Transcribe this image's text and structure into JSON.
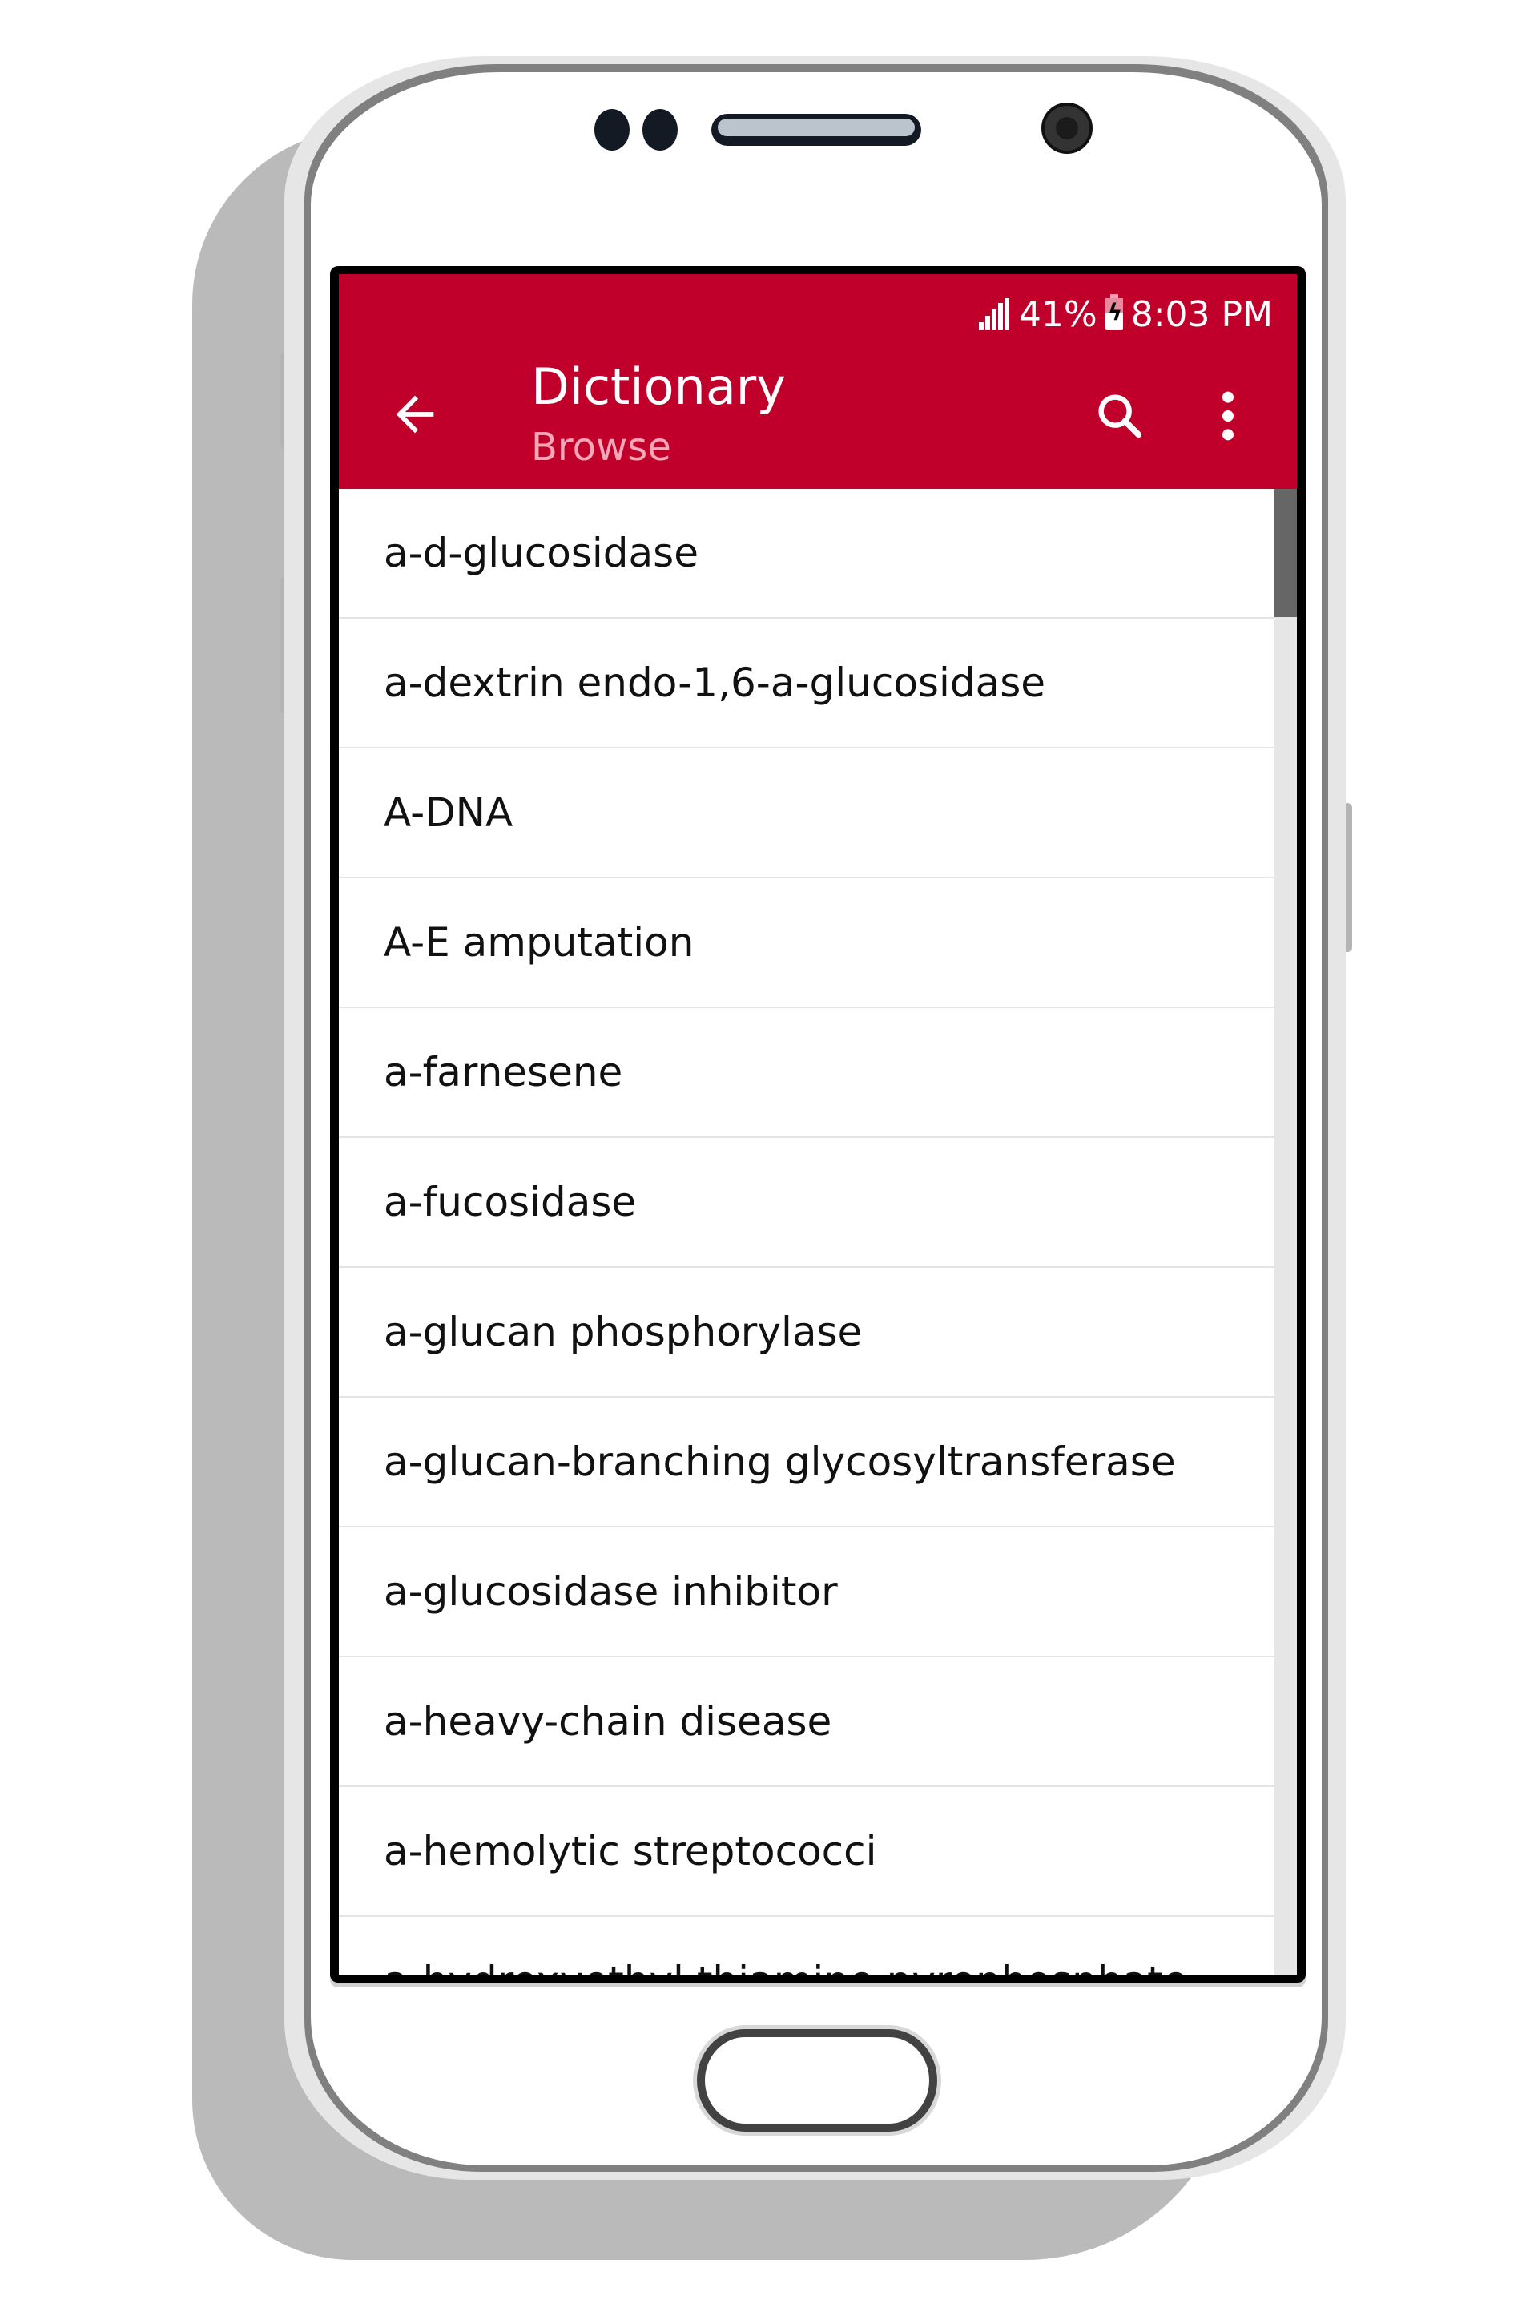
{
  "status_bar": {
    "signal_icon": "signal-icon",
    "battery_percent": "41%",
    "battery_icon": "battery-charging-icon",
    "time": "8:03 PM"
  },
  "app_bar": {
    "back_icon": "arrow-back-icon",
    "title": "Dictionary",
    "subtitle": "Browse",
    "search_icon": "search-icon",
    "more_icon": "more-vert-icon",
    "color": "#C0002A"
  },
  "list": {
    "items": [
      "a-d-glucosidase",
      "a-dextrin endo-1,6-a-glucosidase",
      "A-DNA",
      "A-E amputation",
      "a-farnesene",
      "a-fucosidase",
      "a-glucan phosphorylase",
      "a-glucan-branching glycosyltransferase",
      "a-glucosidase inhibitor",
      "a-heavy-chain disease",
      "a-hemolytic streptococci",
      "a-hydroxyethyl thiamine pyrophosphate"
    ],
    "scroll_position": 0.0
  }
}
